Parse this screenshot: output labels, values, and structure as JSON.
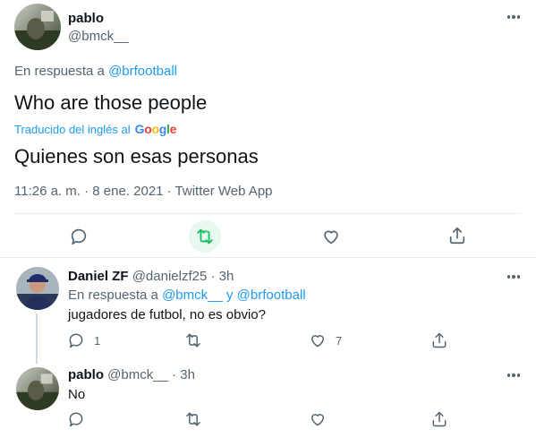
{
  "main_tweet": {
    "display_name": "pablo",
    "handle": "@bmck__",
    "reply_prefix": "En respuesta a",
    "reply_to": "@brfootball",
    "text": "Who are those people",
    "translated_label": "Traducido del inglés al",
    "google_label": "Google",
    "google_colors": [
      "#4285f4",
      "#ea4335",
      "#fbbc05",
      "#4285f4",
      "#34a853",
      "#ea4335"
    ],
    "translation": "Quienes son esas personas",
    "meta": "11:26 a. m. · 8 ene. 2021 · Twitter Web App",
    "retweet_active_color": "#17bf63"
  },
  "replies": [
    {
      "display_name": "Daniel ZF",
      "handle": "@danielzf25",
      "sep": "·",
      "time": "3h",
      "reply_prefix": "En respuesta a",
      "reply_to_1": "@bmck__",
      "reply_conj": "y",
      "reply_to_2": "@brfootball",
      "text": "jugadores de futbol, no es obvio?",
      "reply_count": "1",
      "like_count": "7"
    },
    {
      "display_name": "pablo",
      "handle": "@bmck__",
      "sep": "·",
      "time": "3h",
      "text": "No"
    }
  ],
  "colors": {
    "accent": "#1d9bf0",
    "text": "#0f1419",
    "muted": "#536471",
    "retweet": "#17bf63"
  }
}
